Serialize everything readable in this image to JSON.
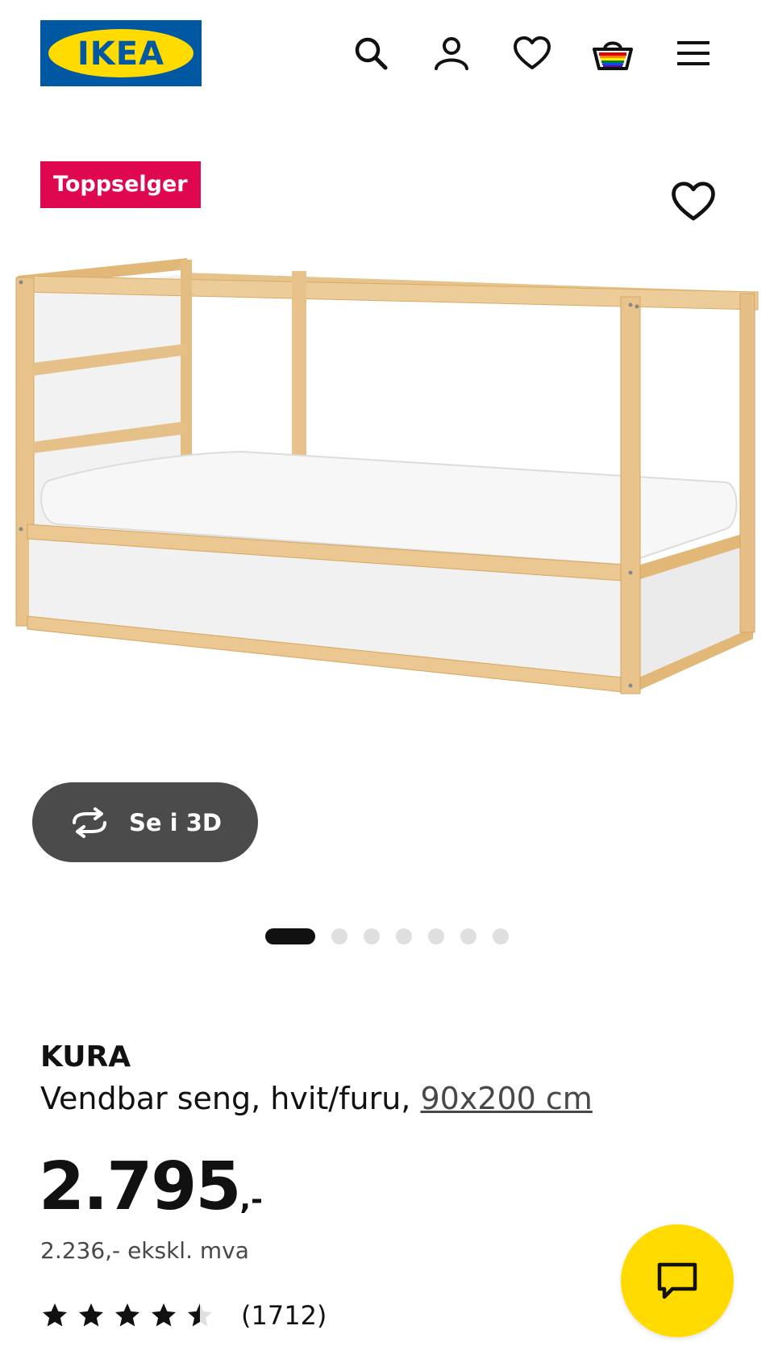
{
  "header": {
    "logo_text": "IKEA",
    "icons": [
      "search-icon",
      "account-icon",
      "favourites-icon",
      "shopping-bag-icon",
      "menu-icon"
    ]
  },
  "product": {
    "badge": "Toppselger",
    "view_3d_label": "Se i 3D",
    "name": "KURA",
    "description": "Vendbar seng, hvit/furu,",
    "size": "90x200 cm",
    "price_main": "2.795",
    "price_suffix": ",-",
    "price_ex_vat": "2.236,- ekskl. mva",
    "rating_value": 4.5,
    "rating_max": 5,
    "review_count": "(1712)",
    "image_count": 7,
    "active_image": 1
  },
  "colors": {
    "ikea_blue": "#0058a3",
    "ikea_yellow": "#ffdb00",
    "badge_red": "#e00751",
    "button_dark": "#4b4b4b"
  }
}
